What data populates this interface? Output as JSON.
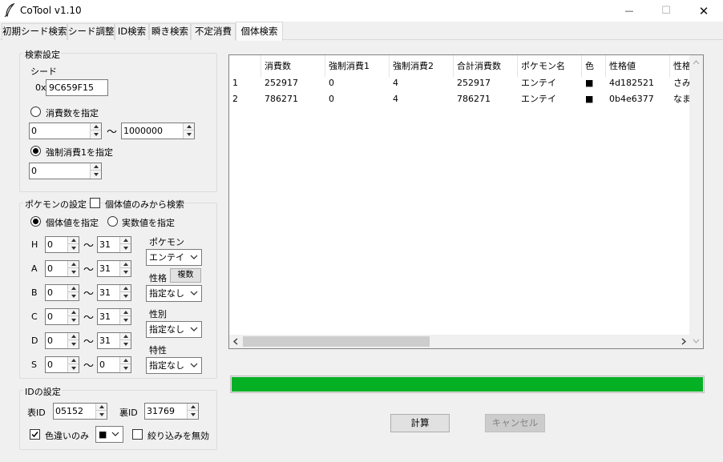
{
  "window": {
    "title": "CoTool v1.10",
    "minimize": "—",
    "maximize": "☐",
    "close": "✕"
  },
  "tabs": [
    {
      "label": "初期シード検索"
    },
    {
      "label": "シード調整"
    },
    {
      "label": "ID検索"
    },
    {
      "label": "瞬き検索"
    },
    {
      "label": "不定消費"
    },
    {
      "label": "個体検索"
    }
  ],
  "search_settings": {
    "legend": "検索設定",
    "seed_label": "シード",
    "seed_prefix": "0x",
    "seed_value": "9C659F15",
    "consume_radio_label": "消費数を指定",
    "consume_min": "0",
    "consume_max": "1000000",
    "tilde": "～",
    "forced_radio_label": "強制消費1を指定",
    "forced_value": "0"
  },
  "pokemon_settings": {
    "legend": "ポケモンの設定",
    "iv_only_label": "個体値のみから検索",
    "iv_radio_label": "個体値を指定",
    "actual_radio_label": "実数値を指定",
    "tilde": "～",
    "stats": [
      {
        "name": "H",
        "min": "0",
        "max": "31"
      },
      {
        "name": "A",
        "min": "0",
        "max": "31"
      },
      {
        "name": "B",
        "min": "0",
        "max": "31"
      },
      {
        "name": "C",
        "min": "0",
        "max": "31"
      },
      {
        "name": "D",
        "min": "0",
        "max": "31"
      },
      {
        "name": "S",
        "min": "0",
        "max": "0"
      }
    ],
    "pokemon_label": "ポケモン",
    "pokemon_value": "エンテイ",
    "nature_label": "性格",
    "nature_multi_button": "複数",
    "nature_value": "指定なし",
    "gender_label": "性別",
    "gender_value": "指定なし",
    "ability_label": "特性",
    "ability_value": "指定なし"
  },
  "id_settings": {
    "legend": "IDの設定",
    "tid_label": "表ID",
    "tid_value": "05152",
    "sid_label": "裏ID",
    "sid_value": "31769",
    "shiny_only_label": "色違いのみ",
    "shiny_symbol": "■",
    "disable_filter_label": "絞り込みを無効"
  },
  "results": {
    "columns": [
      "",
      "消費数",
      "強制消費1",
      "強制消費2",
      "合計消費数",
      "ポケモン名",
      "色",
      "性格値",
      "性格"
    ],
    "rows": [
      [
        "1",
        "252917",
        "0",
        "4",
        "252917",
        "エンテイ",
        "■",
        "4d182521",
        "さみ"
      ],
      [
        "2",
        "786271",
        "0",
        "4",
        "786271",
        "エンテイ",
        "■",
        "0b4e6377",
        "なま"
      ]
    ]
  },
  "progress": {
    "value": 1.0,
    "color": "#06b025"
  },
  "actions": {
    "calculate": "計算",
    "cancel": "キャンセル"
  }
}
